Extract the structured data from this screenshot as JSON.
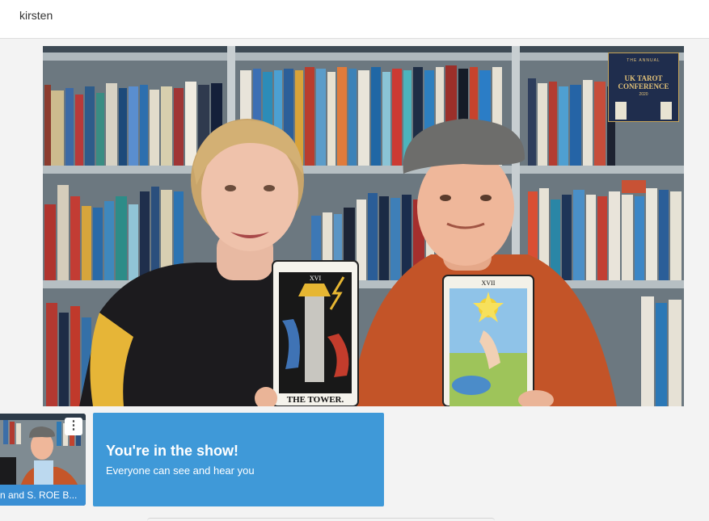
{
  "header": {
    "username": "kirsten"
  },
  "stage": {
    "video_alt": "Two presenters holding tarot cards in front of bookshelves",
    "left_card": "THE TOWER.",
    "left_card_number": "XVI",
    "right_card_number": "XVII",
    "badge": {
      "top": "THE ANNUAL",
      "line1": "UK TAROT",
      "line2": "CONFERENCE",
      "year": "2020"
    }
  },
  "participant_thumb": {
    "name": "n and S. ROE B...",
    "menu_icon": "more-vertical-icon"
  },
  "notice": {
    "title": "You're in the show!",
    "subtitle": "Everyone can see and hear you"
  },
  "colors": {
    "accent": "#3f99d8",
    "thumb_label": "#3a8fd4",
    "background": "#f3f3f3"
  }
}
